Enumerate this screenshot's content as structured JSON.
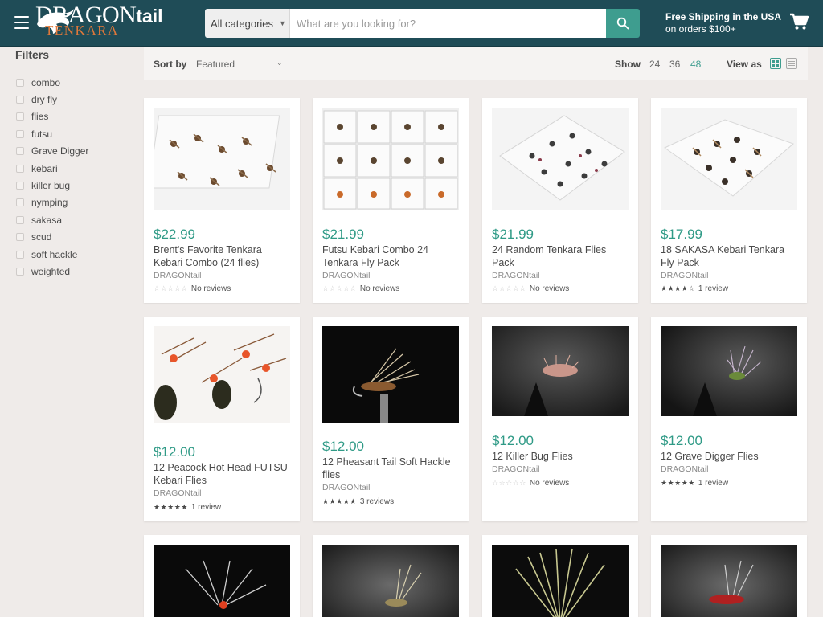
{
  "header": {
    "logo_main": "DRAGON",
    "logo_main_small": "tail",
    "logo_sub": "TENKARA",
    "category_label": "All categories",
    "search_placeholder": "What are you looking for?",
    "shipping_line1": "Free Shipping in the USA",
    "shipping_line2": "on orders $100+",
    "accent": "#3e9d8f",
    "bg": "#1f4c57"
  },
  "sidebar": {
    "title": "Filters",
    "items": [
      "combo",
      "dry fly",
      "flies",
      "futsu",
      "Grave Digger",
      "kebari",
      "killer bug",
      "nymping",
      "sakasa",
      "scud",
      "soft hackle",
      "weighted"
    ]
  },
  "toolbar": {
    "sort_label": "Sort by",
    "sort_value": "Featured",
    "show_label": "Show",
    "show_options": [
      "24",
      "36",
      "48"
    ],
    "show_selected": "48",
    "view_label": "View as"
  },
  "products": [
    {
      "price": "$22.99",
      "title": "Brent's Favorite Tenkara Kebari Combo (24 flies)",
      "vendor": "DRAGONtail",
      "stars": "☆☆☆☆☆",
      "rating_text": "No reviews",
      "rating": 0
    },
    {
      "price": "$21.99",
      "title": "Futsu Kebari Combo 24 Tenkara Fly Pack",
      "vendor": "DRAGONtail",
      "stars": "☆☆☆☆☆",
      "rating_text": "No reviews",
      "rating": 0
    },
    {
      "price": "$21.99",
      "title": "24 Random Tenkara Flies Pack",
      "vendor": "DRAGONtail",
      "stars": "☆☆☆☆☆",
      "rating_text": "No reviews",
      "rating": 0
    },
    {
      "price": "$17.99",
      "title": "18 SAKASA Kebari Tenkara Fly Pack",
      "vendor": "DRAGONtail",
      "stars": "★★★★☆",
      "rating_text": "1 review",
      "rating": 4
    },
    {
      "price": "$12.00",
      "title": "12 Peacock Hot Head FUTSU Kebari Flies",
      "vendor": "DRAGONtail",
      "stars": "★★★★★",
      "rating_text": "1 review",
      "rating": 5
    },
    {
      "price": "$12.00",
      "title": "12 Pheasant Tail Soft Hackle flies",
      "vendor": "DRAGONtail",
      "stars": "★★★★★",
      "rating_text": "3 reviews",
      "rating": 5
    },
    {
      "price": "$12.00",
      "title": "12 Killer Bug Flies",
      "vendor": "DRAGONtail",
      "stars": "☆☆☆☆☆",
      "rating_text": "No reviews",
      "rating": 0
    },
    {
      "price": "$12.00",
      "title": "12 Grave Digger Flies",
      "vendor": "DRAGONtail",
      "stars": "★★★★★",
      "rating_text": "1 review",
      "rating": 5
    }
  ]
}
